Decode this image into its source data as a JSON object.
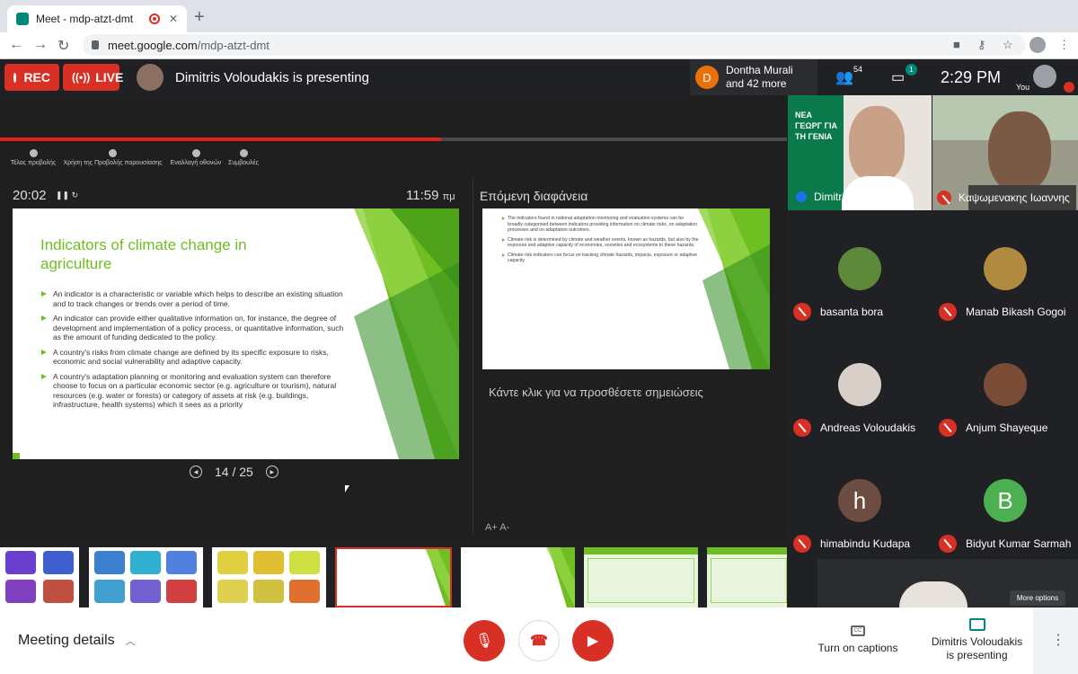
{
  "browser": {
    "tab_title": "Meet - mdp-atzt-dmt",
    "url_domain": "meet.google.com",
    "url_path": "/mdp-atzt-dmt"
  },
  "topbar": {
    "rec_label": "REC",
    "live_label": "LIVE",
    "presenting_text": "Dimitris Voloudakis is presenting",
    "others_initial": "D",
    "others_line1": "Dontha Murali",
    "others_line2": "and 42 more",
    "people_count": "54",
    "chat_badge": "1",
    "time": "2:29 PM",
    "you_label": "You"
  },
  "presenter_view": {
    "tools": [
      "Τέλος προβολής",
      "Χρήση της Προβολής παρουσίασης",
      "Εναλλαγή οθονών",
      "Συμβουλές"
    ],
    "timer": "20:02",
    "time_of_day": "11:59",
    "time_suffix": "πμ",
    "next_label": "Επόμενη διαφάνεια",
    "slide_counter": "14 / 25",
    "notes_placeholder": "Κάντε κλικ για να προσθέσετε σημειώσεις",
    "font_ctrl": "A+  A-",
    "progress_fraction": 0.56
  },
  "slide": {
    "title": "Indicators of climate change in agriculture",
    "bullets": [
      "An indicator is a characteristic or variable which helps to describe an existing situation and to track changes or trends over a period of time.",
      "An indicator can provide either qualitative information on, for instance, the degree of development and implementation of a policy process, or quantitative information, such as the amount of funding dedicated to the policy.",
      "A country's risks from climate change are defined by its specific exposure to risks, economic and social vulnerability and adaptive capacity.",
      "A country's adaptation planning or monitoring and evaluation system can therefore choose to focus on a particular economic sector (e.g. agriculture or tourism), natural resources (e.g. water or forests) or category of assets at risk (e.g. buildings, infrastructure, health systems) which it sees as a priority"
    ]
  },
  "next_slide": {
    "bullets": [
      "The indicators found in national adaptation monitoring and evaluation systems can be broadly categorised between indicators providing information on climate risks, on adaptation processes and on adaptation outcomes.",
      "Climate risk is determined by climate and weather events, known as hazards, but also by the exposure and adaptive capacity of economies, societies and ecosystems to these hazards.",
      "Climate risk indicators can focus on tracking climate hazards, impacts, exposure or adaptive capacity"
    ]
  },
  "participants": {
    "video": [
      {
        "name": "Dimitris Voloudakis"
      },
      {
        "name": "Καψωμενακης Ιωαννης"
      }
    ],
    "sign_text": "ΝΕΑ ΓΕΩΡΓ ΓΙΑ ΤΗ ΓΕΝΙΑ",
    "tiles": [
      {
        "name": "basanta bora",
        "color": "#5d8a3a"
      },
      {
        "name": "Manab Bikash Gogoi",
        "color": "#b08a3e"
      },
      {
        "name": "Andreas Voloudakis",
        "color": "#d8d0c8"
      },
      {
        "name": "Anjum Shayeque",
        "color": "#7a4b35"
      },
      {
        "name": "himabindu Kudapa",
        "initial": "h",
        "color": "#6d4c41"
      },
      {
        "name": "Bidyut Kumar Sarmah",
        "initial": "B",
        "color": "#4caf50"
      }
    ],
    "more_options": "More options"
  },
  "bottombar": {
    "meeting_details": "Meeting details",
    "captions": "Turn on captions",
    "presenting_line1": "Dimitris Voloudakis",
    "presenting_line2": "is presenting"
  },
  "icons": {
    "mic": "mic-off-icon",
    "hangup": "hangup-icon",
    "cam": "videocam-off-icon"
  },
  "colors": {
    "rec_red": "#d93025",
    "accent_green": "#6fbf23",
    "teal": "#00897b"
  }
}
